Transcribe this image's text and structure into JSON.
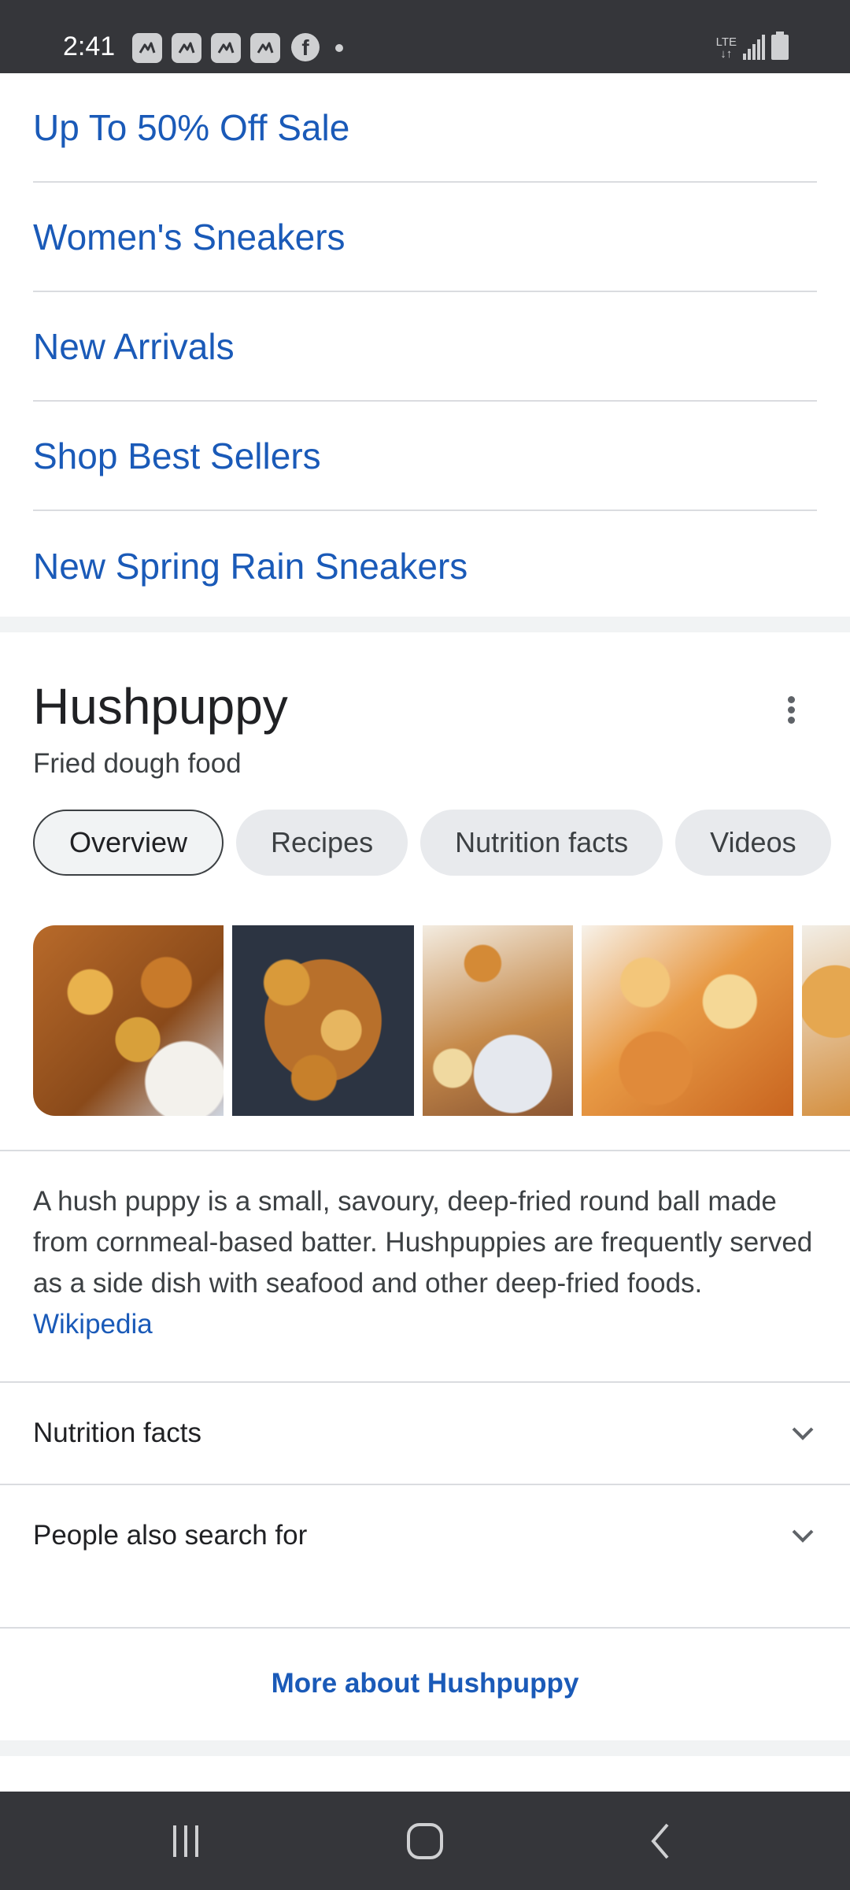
{
  "status_bar": {
    "time": "2:41",
    "network": "LTE",
    "notification_icons": [
      "picture-icon",
      "picture-icon",
      "picture-icon",
      "picture-icon",
      "facebook-icon"
    ]
  },
  "links": [
    {
      "label": "Up To 50% Off Sale"
    },
    {
      "label": "Women's Sneakers"
    },
    {
      "label": "New Arrivals"
    },
    {
      "label": "Shop Best Sellers"
    },
    {
      "label": "New Spring Rain Sneakers"
    }
  ],
  "knowledge_panel": {
    "title": "Hushpuppy",
    "subtitle": "Fried dough food",
    "chips": [
      {
        "label": "Overview",
        "active": true
      },
      {
        "label": "Recipes"
      },
      {
        "label": "Nutrition facts"
      },
      {
        "label": "Videos"
      }
    ],
    "description": "A hush puppy is a small, savoury, deep-fried round ball made from cornmeal-based batter. Hushpuppies are frequently served as a side dish with seafood and other deep-fried foods.",
    "source_link": "Wikipedia",
    "accordions": [
      {
        "label": "Nutrition facts"
      },
      {
        "label": "People also search for"
      }
    ],
    "more_link": "More about Hushpuppy"
  },
  "colors": {
    "link": "#1a5ab8",
    "status_bar": "#35363a"
  }
}
